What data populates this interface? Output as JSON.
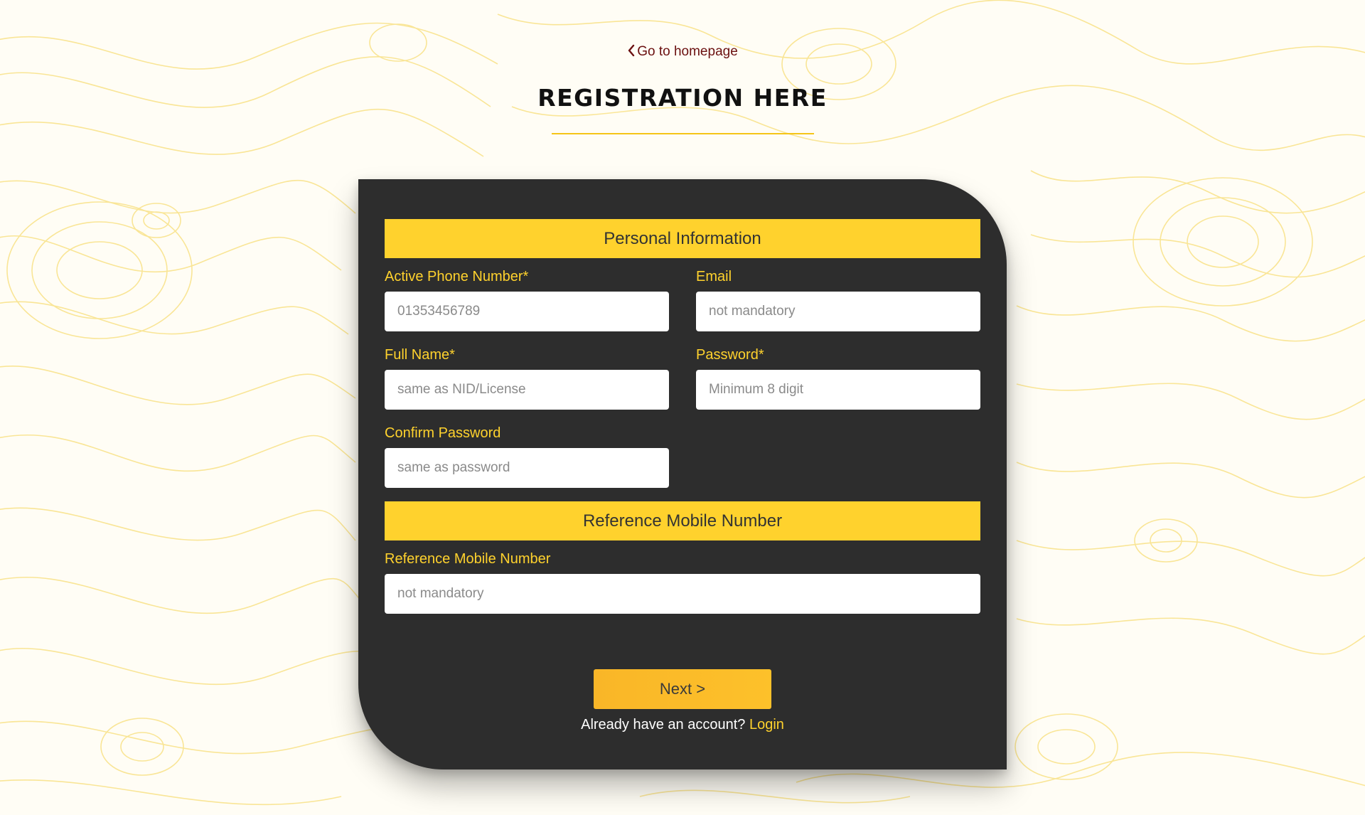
{
  "nav": {
    "back_label": "Go to homepage"
  },
  "header": {
    "title": "REGISTRATION HERE"
  },
  "personal": {
    "heading": "Personal Information",
    "phone": {
      "label": "Active Phone Number*",
      "placeholder": "01353456789"
    },
    "email": {
      "label": "Email",
      "placeholder": "not mandatory"
    },
    "full_name": {
      "label": "Full Name*",
      "placeholder": "same as NID/License"
    },
    "password": {
      "label": "Password*",
      "placeholder": "Minimum 8 digit"
    },
    "confirm_password": {
      "label": "Confirm Password",
      "placeholder": "same as password"
    }
  },
  "reference": {
    "heading": "Reference Mobile Number",
    "field": {
      "label": "Reference Mobile Number",
      "placeholder": "not mandatory"
    }
  },
  "actions": {
    "next_label": "Next >",
    "login_prompt": "Already have an account?",
    "login_label": "Login"
  },
  "colors": {
    "accent": "#ffd22d",
    "card_background": "#2d2d2d",
    "button": "#fdbb2a",
    "back_link": "#6b1010"
  },
  "icons": {
    "back": "chevron-left-icon"
  }
}
